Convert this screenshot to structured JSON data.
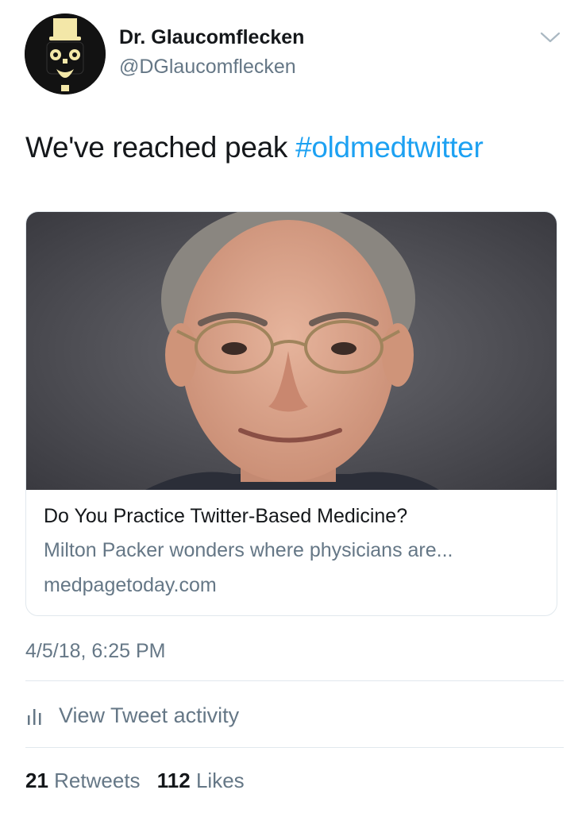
{
  "author": {
    "name": "Dr. Glaucomflecken",
    "handle": "@DGlaucomflecken",
    "avatar_icon": "top-hat-character-avatar"
  },
  "tweet": {
    "text": "We've reached peak ",
    "hashtag": "#oldmedtwitter"
  },
  "card": {
    "image_alt": "portrait-photo",
    "title": "Do You Practice Twitter-Based Medicine?",
    "description": "Milton Packer wonders where physicians are...",
    "domain": "medpagetoday.com"
  },
  "timestamp": "4/5/18, 6:25 PM",
  "activity": {
    "label": "View Tweet activity",
    "icon": "bar-chart-icon"
  },
  "stats": {
    "retweets_count": "21",
    "retweets_label": "Retweets",
    "likes_count": "112",
    "likes_label": "Likes"
  },
  "colors": {
    "link": "#1da1f2",
    "secondary_text": "#657786",
    "primary_text": "#14171a",
    "border": "#e1e8ed"
  }
}
